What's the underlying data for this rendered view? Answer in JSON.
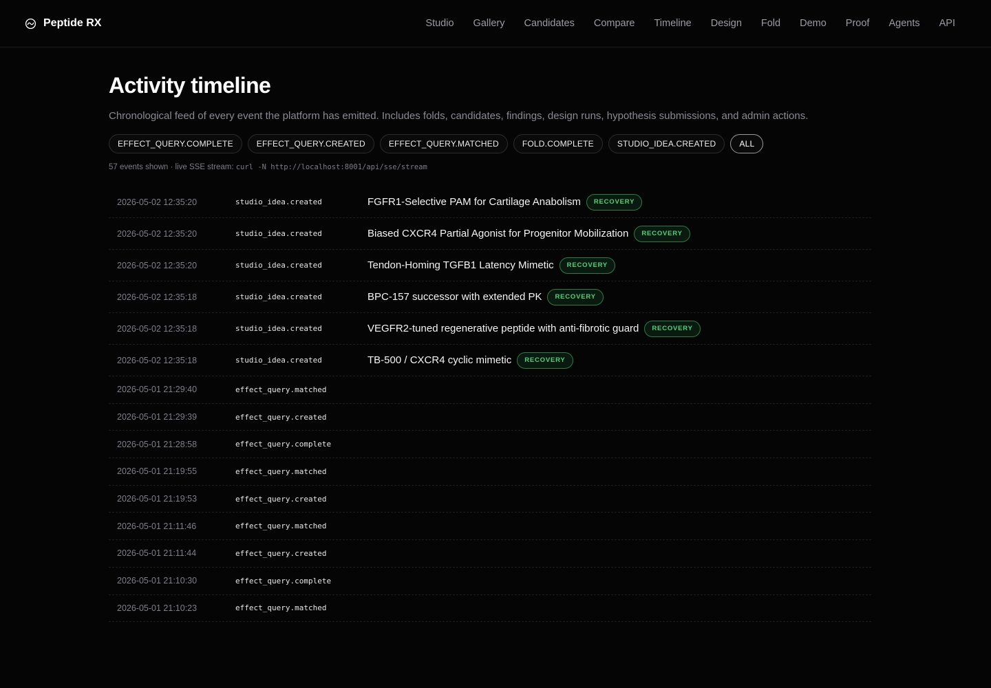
{
  "app": {
    "name": "Peptide RX"
  },
  "nav": [
    "Studio",
    "Gallery",
    "Candidates",
    "Compare",
    "Timeline",
    "Design",
    "Fold",
    "Demo",
    "Proof",
    "Agents",
    "API"
  ],
  "page": {
    "title": "Activity timeline",
    "subtitle": "Chronological feed of every event the platform has emitted. Includes folds, candidates, findings, design runs, hypothesis submissions, and admin actions."
  },
  "filters": [
    "EFFECT_QUERY.COMPLETE",
    "EFFECT_QUERY.CREATED",
    "EFFECT_QUERY.MATCHED",
    "FOLD.COMPLETE",
    "STUDIO_IDEA.CREATED",
    "ALL"
  ],
  "active_filter": "ALL",
  "meta": {
    "count_text": "57 events shown · live SSE stream: ",
    "command": "curl -N http://localhost:8001/api/sse/stream"
  },
  "colors": {
    "accent_green": "#4ed27a",
    "background": "#050505"
  },
  "events": [
    {
      "time": "2026-05-02 12:35:20",
      "type": "studio_idea.created",
      "title": "FGFR1-Selective PAM for Cartilage Anabolism",
      "badge": "RECOVERY"
    },
    {
      "time": "2026-05-02 12:35:20",
      "type": "studio_idea.created",
      "title": "Biased CXCR4 Partial Agonist for Progenitor Mobilization",
      "badge": "RECOVERY"
    },
    {
      "time": "2026-05-02 12:35:20",
      "type": "studio_idea.created",
      "title": "Tendon-Homing TGFB1 Latency Mimetic",
      "badge": "RECOVERY"
    },
    {
      "time": "2026-05-02 12:35:18",
      "type": "studio_idea.created",
      "title": "BPC-157 successor with extended PK",
      "badge": "RECOVERY"
    },
    {
      "time": "2026-05-02 12:35:18",
      "type": "studio_idea.created",
      "title": "VEGFR2-tuned regenerative peptide with anti-fibrotic guard",
      "badge": "RECOVERY"
    },
    {
      "time": "2026-05-02 12:35:18",
      "type": "studio_idea.created",
      "title": "TB-500 / CXCR4 cyclic mimetic",
      "badge": "RECOVERY"
    },
    {
      "time": "2026-05-01 21:29:40",
      "type": "effect_query.matched"
    },
    {
      "time": "2026-05-01 21:29:39",
      "type": "effect_query.created"
    },
    {
      "time": "2026-05-01 21:28:58",
      "type": "effect_query.complete"
    },
    {
      "time": "2026-05-01 21:19:55",
      "type": "effect_query.matched"
    },
    {
      "time": "2026-05-01 21:19:53",
      "type": "effect_query.created"
    },
    {
      "time": "2026-05-01 21:11:46",
      "type": "effect_query.matched"
    },
    {
      "time": "2026-05-01 21:11:44",
      "type": "effect_query.created"
    },
    {
      "time": "2026-05-01 21:10:30",
      "type": "effect_query.complete"
    },
    {
      "time": "2026-05-01 21:10:23",
      "type": "effect_query.matched"
    }
  ]
}
